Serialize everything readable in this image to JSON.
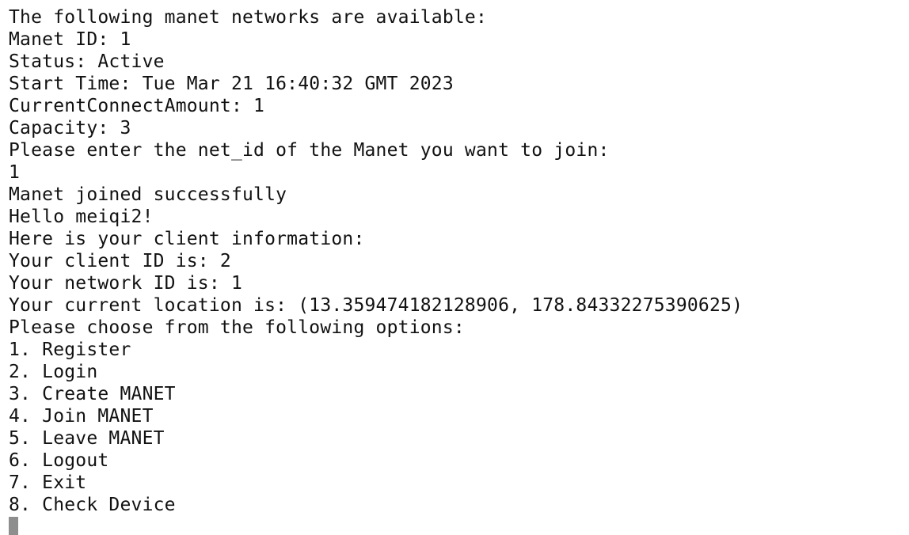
{
  "terminal": {
    "lines": [
      "-",
      "The following manet networks are available:",
      "Manet ID: 1",
      "Status: Active",
      "Start Time: Tue Mar 21 16:40:32 GMT 2023",
      "CurrentConnectAmount: 1",
      "Capacity: 3",
      "Please enter the net_id of the Manet you want to join:",
      "1",
      "Manet joined successfully",
      "Hello meiqi2!",
      "Here is your client information:",
      "Your client ID is: 2",
      "Your network ID is: 1",
      "Your current location is: (13.359474182128906, 178.84332275390625)",
      "Please choose from the following options:",
      "1. Register",
      "2. Login",
      "3. Create MANET",
      "4. Join MANET",
      "5. Leave MANET",
      "6. Logout",
      "7. Exit",
      "8. Check Device"
    ]
  }
}
